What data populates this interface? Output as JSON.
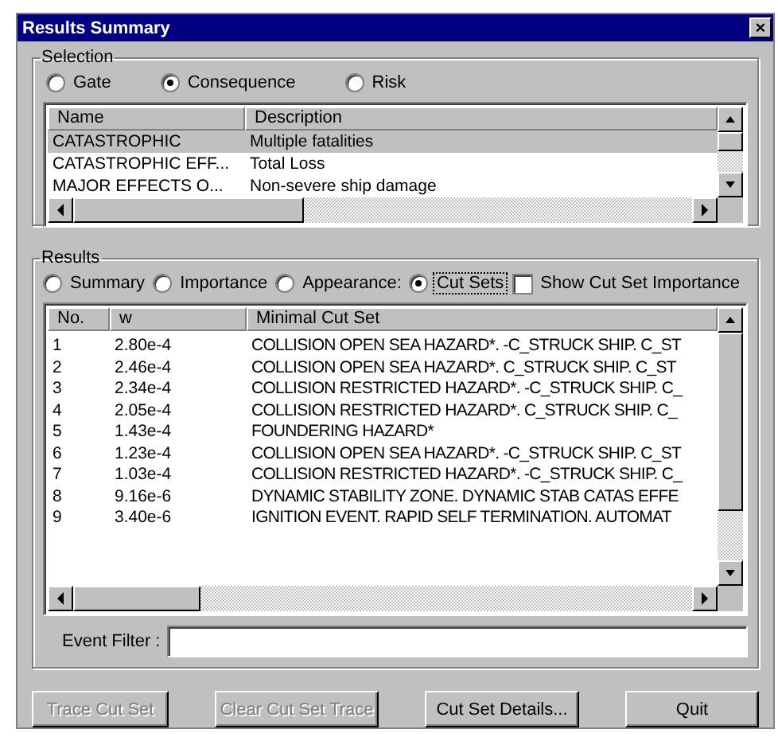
{
  "window": {
    "title": "Results Summary",
    "close": "×"
  },
  "selection": {
    "label": "Selection",
    "options": [
      {
        "label": "Gate",
        "selected": false
      },
      {
        "label": "Consequence",
        "selected": true
      },
      {
        "label": "Risk",
        "selected": false
      }
    ],
    "columns": [
      "Name",
      "Description"
    ],
    "rows": [
      {
        "name": "CATASTROPHIC",
        "description": "Multiple fatalities",
        "selected": true
      },
      {
        "name": "CATASTROPHIC EFF...",
        "description": "Total Loss",
        "selected": false
      },
      {
        "name": "MAJOR EFFECTS O...",
        "description": "Non-severe ship damage",
        "selected": false
      }
    ]
  },
  "results": {
    "label": "Results",
    "options": [
      {
        "label": "Summary",
        "selected": false
      },
      {
        "label": "Importance",
        "selected": false
      },
      {
        "label": "Appearance:",
        "selected": false
      },
      {
        "label": "Cut Sets",
        "selected": true
      }
    ],
    "show_importance": {
      "label": "Show Cut Set Importance",
      "checked": false
    },
    "columns": [
      "No.",
      "w",
      "Minimal Cut Set"
    ],
    "rows": [
      {
        "no": "1",
        "w": "2.80e-4",
        "cut_set": "COLLISION OPEN SEA HAZARD*. -C_STRUCK SHIP. C_ST",
        "selected": false
      },
      {
        "no": "2",
        "w": "2.46e-4",
        "cut_set": "COLLISION OPEN SEA HAZARD*. C_STRUCK SHIP. C_ST",
        "selected": false
      },
      {
        "no": "3",
        "w": "2.34e-4",
        "cut_set": "COLLISION RESTRICTED HAZARD*. -C_STRUCK SHIP. C_",
        "selected": false
      },
      {
        "no": "4",
        "w": "2.05e-4",
        "cut_set": "COLLISION RESTRICTED HAZARD*. C_STRUCK SHIP. C_",
        "selected": false
      },
      {
        "no": "5",
        "w": "1.43e-4",
        "cut_set": "FOUNDERING HAZARD*",
        "selected": false
      },
      {
        "no": "6",
        "w": "1.23e-4",
        "cut_set": "COLLISION OPEN SEA HAZARD*. -C_STRUCK SHIP. C_ST",
        "selected": false
      },
      {
        "no": "7",
        "w": "1.03e-4",
        "cut_set": "COLLISION RESTRICTED HAZARD*. -C_STRUCK SHIP. C_",
        "selected": false
      },
      {
        "no": "8",
        "w": "9.16e-6",
        "cut_set": "DYNAMIC STABILITY ZONE. DYNAMIC STAB CATAS EFFE",
        "selected": false
      },
      {
        "no": "9",
        "w": "3.40e-6",
        "cut_set": "IGNITION EVENT. RAPID SELF TERMINATION. AUTOMAT",
        "selected": false
      }
    ],
    "event_filter": {
      "label": "Event Filter :"
    }
  },
  "buttons": [
    {
      "label": "Trace Cut Set",
      "disabled": true
    },
    {
      "label": "Clear Cut Set Trace",
      "disabled": true
    },
    {
      "label": "Cut Set Details...",
      "disabled": false
    },
    {
      "label": "Quit",
      "disabled": false
    }
  ]
}
